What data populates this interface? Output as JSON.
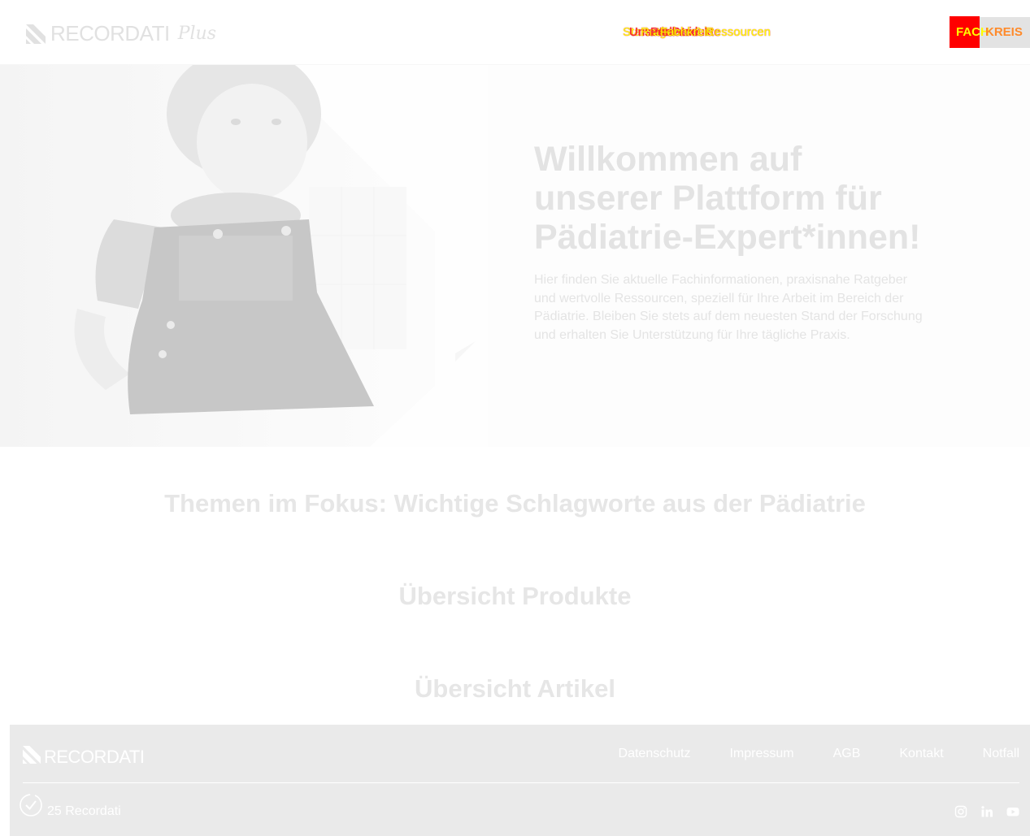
{
  "header": {
    "logo_brand": "RECORDATI",
    "logo_suffix": "Plus",
    "nav": [
      "Startseite",
      "Unsere Produkte",
      "Ratgeber & Ressourcen",
      "Pädiatrie",
      "Fachkreis"
    ],
    "button_primary": "FACH",
    "button_secondary": "KREIS"
  },
  "hero": {
    "title": "Willkommen auf unserer Plattform für Pädiatrie-Expert*innen!",
    "description": "Hier finden Sie aktuelle Fachinformationen, praxisnahe Ratgeber und wertvolle Ressourcen, speziell für Ihre Arbeit im Bereich der Pädiatrie. Bleiben Sie stets auf dem neuesten Stand der Forschung und erhalten Sie Unterstützung für Ihre tägliche Praxis."
  },
  "sections": {
    "topics": "Themen im Fokus: Wichtige Schlagworte aus der Pädiatrie",
    "products": "Übersicht Produkte",
    "articles": "Übersicht Artikel"
  },
  "footer": {
    "logo_brand": "RECORDATI",
    "links": [
      "Datenschutz",
      "Impressum",
      "AGB",
      "Kontakt",
      "Notfall"
    ],
    "copyright": "25 Recordati"
  },
  "colors": {
    "accent_red": "#ff0000",
    "accent_yellow": "#ffff00",
    "footer_bg": "#eaeaea"
  }
}
